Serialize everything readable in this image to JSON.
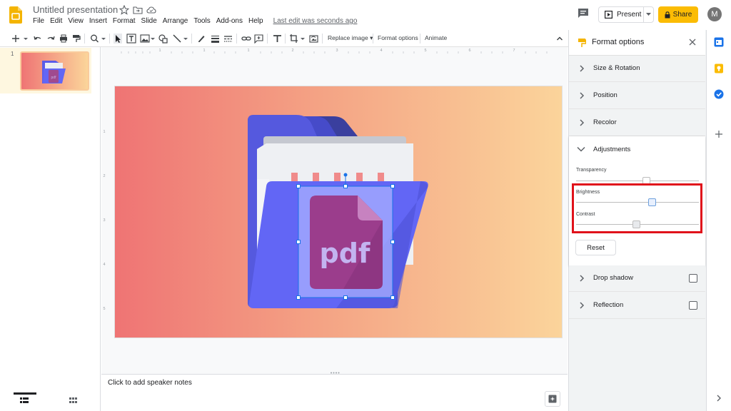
{
  "header": {
    "title": "Untitled presentation",
    "menus": [
      "File",
      "Edit",
      "View",
      "Insert",
      "Format",
      "Slide",
      "Arrange",
      "Tools",
      "Add-ons",
      "Help"
    ],
    "last_edit": "Last edit was seconds ago",
    "present_label": "Present",
    "share_label": "Share",
    "avatar_letter": "M",
    "icons": [
      "star-icon",
      "folder-move-icon",
      "cloud-saved-icon",
      "comment-icon",
      "lock-icon"
    ]
  },
  "toolbar": {
    "replace_image": "Replace image",
    "format_options": "Format options",
    "animate": "Animate"
  },
  "filmstrip": {
    "slide_number": "1"
  },
  "slide": {
    "pdf_label": "pdf"
  },
  "notes": {
    "placeholder": "Click to add speaker notes"
  },
  "format_panel": {
    "title": "Format options",
    "sections": {
      "size_rotation": "Size & Rotation",
      "position": "Position",
      "recolor": "Recolor",
      "adjustments": "Adjustments",
      "drop_shadow": "Drop shadow",
      "reflection": "Reflection"
    },
    "adjustments": {
      "transparency_label": "Transparency",
      "brightness_label": "Brightness",
      "contrast_label": "Contrast",
      "transparency_value": 0.57,
      "brightness_value": 0.62,
      "contrast_value": 0.49,
      "reset_label": "Reset"
    }
  },
  "colors": {
    "accent_yellow": "#fbbc04",
    "highlight_red": "#e0121b",
    "folder_blue": "#5c63f2",
    "pdf_purple": "#9b3d8c"
  }
}
